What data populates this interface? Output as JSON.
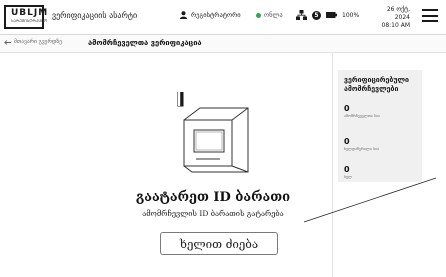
{
  "header": {
    "logo_text": "UBLJM",
    "logo_sub": "ᲡᲐᲠᲔᲒᲘᲡᲢᲠᲐᲪᲘᲝ",
    "app_title": "ვერიფიკაციის ასარტი",
    "user_name": "რეგისტრატორი",
    "connection_status": "ონლა",
    "badge_count": "5",
    "battery": "100%",
    "date": "26 ოქტ, 2024",
    "time": "08:10 AM"
  },
  "subheader": {
    "back_label": "მთავარი გვერდზე",
    "page_title": "ამომრჩეველთა ვერიფიკაცია"
  },
  "main": {
    "title": "გაატარეთ ID ბარათი",
    "subtitle": "ამომრჩევლის ID ბარათის გატარება",
    "manual_button": "ხელით ძიება"
  },
  "stats": {
    "title": "ვერიფიცირებული ამომრჩევლები",
    "items": [
      {
        "value": "0",
        "label": "ამომრჩეველთა სია"
      },
      {
        "value": "0",
        "label": "ხელდაწერილი სია"
      },
      {
        "value": "0",
        "label": "სულ"
      }
    ]
  },
  "colors": {
    "accent": "#1a1a1a",
    "status_online": "#2fa84f",
    "card_bg": "#f0f0f0"
  }
}
